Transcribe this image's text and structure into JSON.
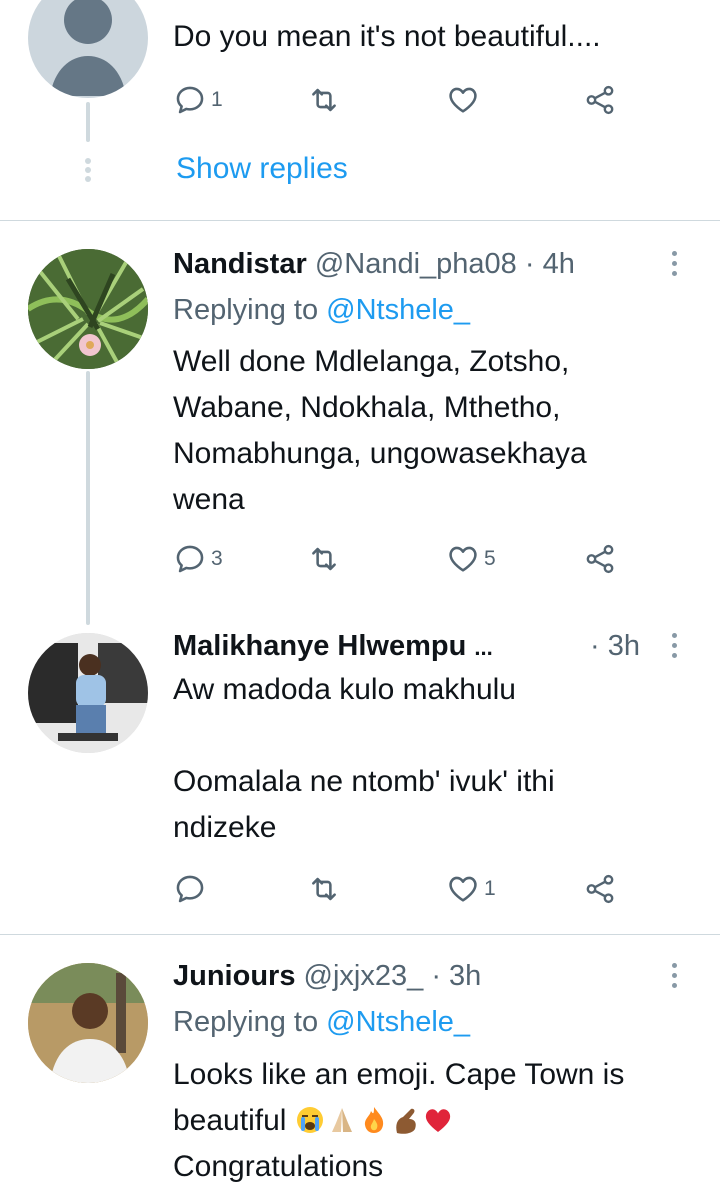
{
  "tweet1": {
    "text": "Do you mean it's not beautiful....",
    "reply_count": "1",
    "show_replies": "Show replies"
  },
  "tweet2": {
    "name": "Nandistar",
    "handle": "@Nandi_pha08",
    "time": "· 4h",
    "replying_prefix": "Replying to",
    "replying_handle": "@Ntshele_",
    "text_lines": [
      "Well done Mdlelanga, Zotsho,",
      "Wabane, Ndokhala, Mthetho,",
      "Nomabhunga, ungowasekhaya",
      "wena"
    ],
    "reply_count": "3",
    "like_count": "5"
  },
  "tweet3": {
    "name": "Malikhanye Hlwempu",
    "ellipsis": "...",
    "time": "· 3h",
    "text_lines": [
      "Aw madoda kulo makhulu",
      "",
      "Oomalala ne ntomb' ivuk' ithi",
      "ndizeke"
    ],
    "like_count": "1"
  },
  "tweet4": {
    "name": "Juniours",
    "handle": "@jxjx23_",
    "time": "· 3h",
    "replying_prefix": "Replying to",
    "replying_handle": "@Ntshele_",
    "text_line1": "Looks like an emoji. Cape Town is",
    "text_line2": "beautiful",
    "emojis": [
      "crying-face",
      "folded-hands",
      "fire",
      "pinching-hand",
      "red-heart"
    ],
    "text_line3": "Congratulations"
  },
  "icons": {
    "reply": "speech-bubble-icon",
    "retweet": "retweet-icon",
    "like": "heart-icon",
    "share": "share-icon",
    "more": "more-vertical-icon"
  },
  "colors": {
    "accent": "#1d9bf0",
    "muted": "#536471",
    "divider": "#cfd9de",
    "heart": "#e0245e"
  }
}
